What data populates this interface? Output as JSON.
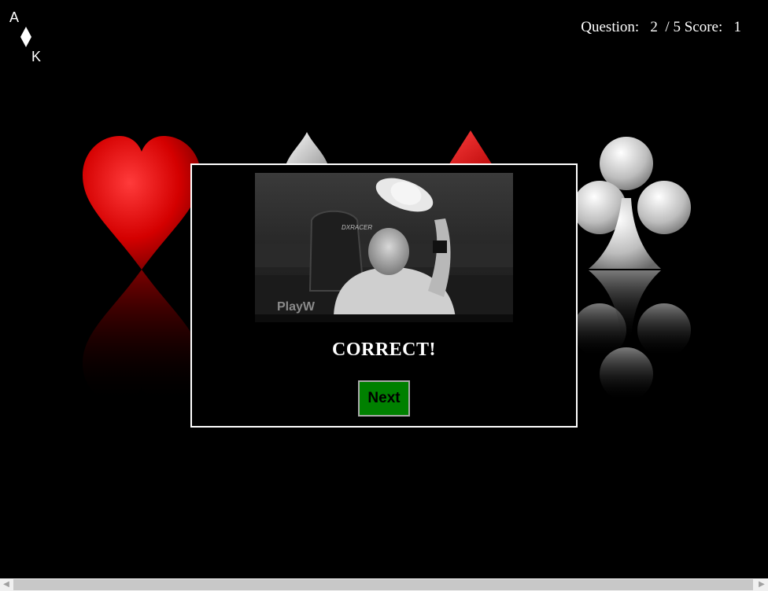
{
  "logo": {
    "top_letter": "A",
    "bottom_letter": "K",
    "icon": "diamond-icon"
  },
  "header": {
    "question_label": "Question:",
    "question_current": "2",
    "question_total": "/ 5",
    "score_label": "Score:",
    "score_value": "1"
  },
  "background": {
    "suits": [
      "heart",
      "spade",
      "diamond",
      "club"
    ],
    "colors": {
      "heart": "#d40000",
      "diamond": "#d40000",
      "spade": "#e0e0e0",
      "club": "#e0e0e0"
    }
  },
  "modal": {
    "result_text": "CORRECT!",
    "next_label": "Next",
    "next_color": "#008000",
    "photo_visible_text": [
      "DXRACER",
      "PlayW"
    ]
  },
  "scrollbar": {
    "left_arrow": "◀",
    "right_arrow": "▶"
  }
}
